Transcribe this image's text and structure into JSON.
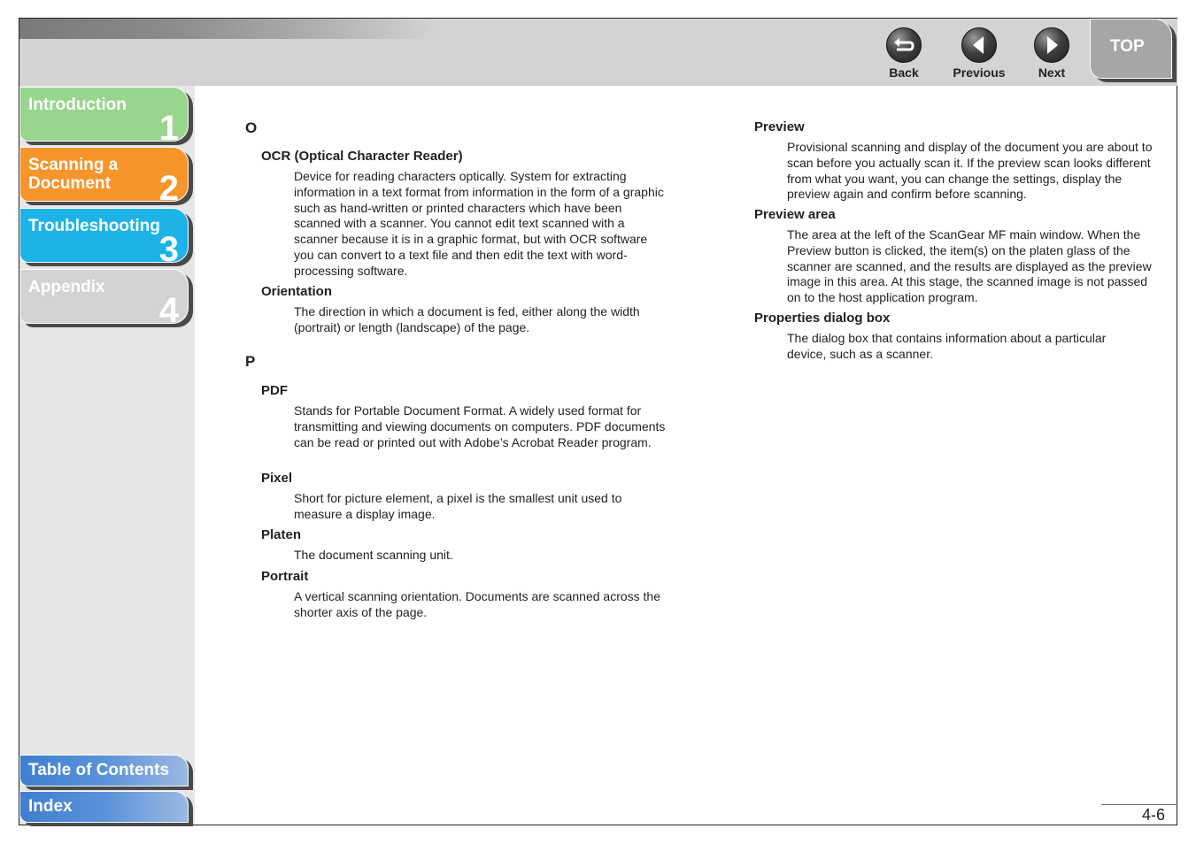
{
  "header": {
    "nav": {
      "back_label": "Back",
      "previous_label": "Previous",
      "next_label": "Next",
      "top_label": "TOP"
    }
  },
  "sidebar": {
    "tabs": [
      {
        "label": "Introduction",
        "number": "1",
        "color": "#98d58d"
      },
      {
        "label": "Scanning a Document",
        "number": "2",
        "color": "#f7942a"
      },
      {
        "label": "Troubleshooting",
        "number": "3",
        "color": "#1eb3e6"
      },
      {
        "label": "Appendix",
        "number": "4",
        "color": "#d3d3d3"
      }
    ],
    "toc_label": "Table of Contents",
    "index_label": "Index"
  },
  "glossary": {
    "left": {
      "sections": [
        {
          "letter": "O",
          "entries": [
            {
              "term": "OCR (Optical Character Reader)",
              "definition": "Device for reading characters optically. System for extracting information in a text format from information in the form of a graphic such as hand-written or printed characters which have been scanned with a scanner. You cannot edit text scanned with a scanner because it is in a graphic format, but with OCR software you can convert to a text file and then edit the text with word-processing software."
            },
            {
              "term": "Orientation",
              "definition": "The direction in which a document is fed, either along the width (portrait) or length (landscape) of the page."
            }
          ]
        },
        {
          "letter": "P",
          "entries": [
            {
              "term": "PDF",
              "definition": "Stands for Portable Document Format. A widely used format for transmitting and viewing documents on computers. PDF documents can be read or printed out with Adobe’s Acrobat Reader program."
            },
            {
              "term": "Pixel",
              "definition": "Short for picture element, a pixel is the smallest unit used to measure a display image."
            },
            {
              "term": "Platen",
              "definition": "The document scanning unit."
            },
            {
              "term": "Portrait",
              "definition": "A vertical scanning orientation. Documents are scanned across the shorter axis of the page."
            }
          ]
        }
      ]
    },
    "right": {
      "entries": [
        {
          "term": "Preview",
          "definition": "Provisional scanning and display of the document you are about to scan before you actually scan it. If the preview scan looks different from what you want, you can change the settings, display the preview again and confirm before scanning."
        },
        {
          "term": "Preview area",
          "definition": "The area at the left of the ScanGear MF main window. When the Preview button is clicked, the item(s) on the platen glass of the scanner are scanned, and the results are displayed as the preview image in this area. At this stage, the scanned image is not passed on to the host application program."
        },
        {
          "term": "Properties dialog box",
          "definition": "The dialog box that contains information about a particular device, such as a scanner."
        }
      ]
    }
  },
  "footer": {
    "page_number": "4-6"
  }
}
